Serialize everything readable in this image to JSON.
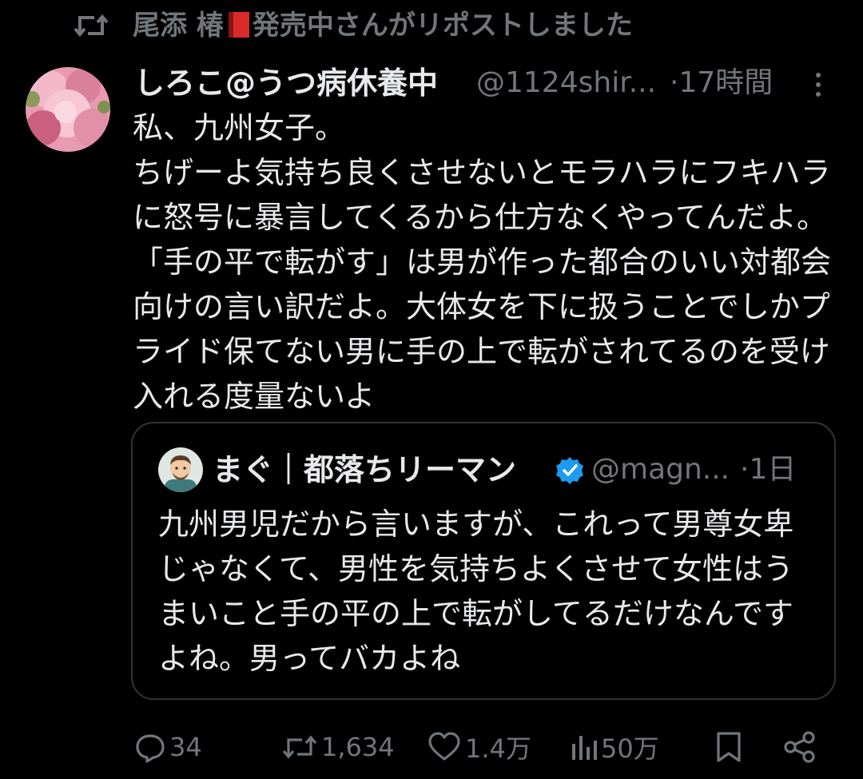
{
  "repost": {
    "icon": "repost-icon",
    "name_prefix": "尾添 椿",
    "name_suffix": "発売中さんがリポストしました"
  },
  "tweet": {
    "display_name": "しろこ@うつ病休養中",
    "handle": "@1124shir...",
    "time": "·17時間",
    "body": "私、九州女子。\nちげーよ気持ち良くさせないとモラハラにフキハラに怒号に暴言してくるから仕方なくやってんだよ。「手の平で転がす」は男が作った都合のいい対都会向けの言い訳だよ。大体女を下に扱うことでしかプライド保てない男に手の上で転がされてるのを受け入れる度量ないよ"
  },
  "quote": {
    "display_name": "まぐ｜都落ちリーマン",
    "handle": "@magn...",
    "time": "·1日",
    "body": "九州男児だから言いますが、これって男尊女卑じゃなくて、男性を気持ちよくさせて女性はうまいこと手の平の上で転がしてるだけなんですよね。男ってバカよね"
  },
  "actions": {
    "replies": "34",
    "reposts": "1,634",
    "likes": "1.4万",
    "views": "50万"
  },
  "colors": {
    "background": "#000000",
    "text": "#e7e9ea",
    "muted": "#71767b",
    "border": "#2f3336",
    "verified": "#1d9bf0"
  }
}
